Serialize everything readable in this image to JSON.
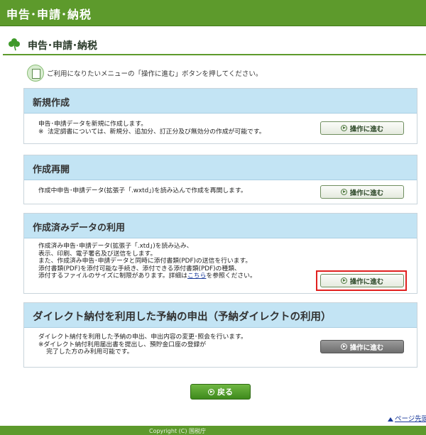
{
  "header": {
    "title": "申告･申請･納税"
  },
  "section": {
    "title": "申告･申請･納税"
  },
  "notice": {
    "text": "ご利用になりたいメニューの「操作に進む」ボタンを押してください。"
  },
  "panels": [
    {
      "title": "新規作成",
      "lines": [
        "申告･申請データを新規に作成します。",
        "※  法定調書については、新規分、追加分、訂正分及び無効分の作成が可能です。"
      ],
      "button": "操作に進む"
    },
    {
      "title": "作成再開",
      "lines": [
        "作成中申告･申請データ(拡張子「.wxtd」)を読み込んで作成を再開します。"
      ],
      "button": "操作に進む"
    },
    {
      "title": "作成済みデータの利用",
      "lines": [
        "作成済み申告･申請データ(拡張子「.xtd」)を読み込み、",
        "表示、印刷、電子署名及び送信をします。",
        "また、作成済み申告･申請データと同時に添付書類(PDF)の送信を行います。",
        "添付書類(PDF)を添付可能な手続き、添付できる添付書類(PDF)の種類、",
        "添付するファイルのサイズに制限があります。詳細は"
      ],
      "link": "こちら",
      "link_suffix": "を参照ください。",
      "button": "操作に進む"
    },
    {
      "title": "ダイレクト納付を利用した予納の申出（予納ダイレクトの利用）",
      "lines": [
        "ダイレクト納付を利用した予納の申出、申出内容の変更･照会を行います。",
        "※ダイレクト納付利用届出書を提出し、預貯金口座の登録が",
        "    完了した方のみ利用可能です。"
      ],
      "button": "操作に進む"
    }
  ],
  "back_button": "戻る",
  "page_top": "ページ先頭",
  "footer_text": "Copyright (C) 国税庁"
}
